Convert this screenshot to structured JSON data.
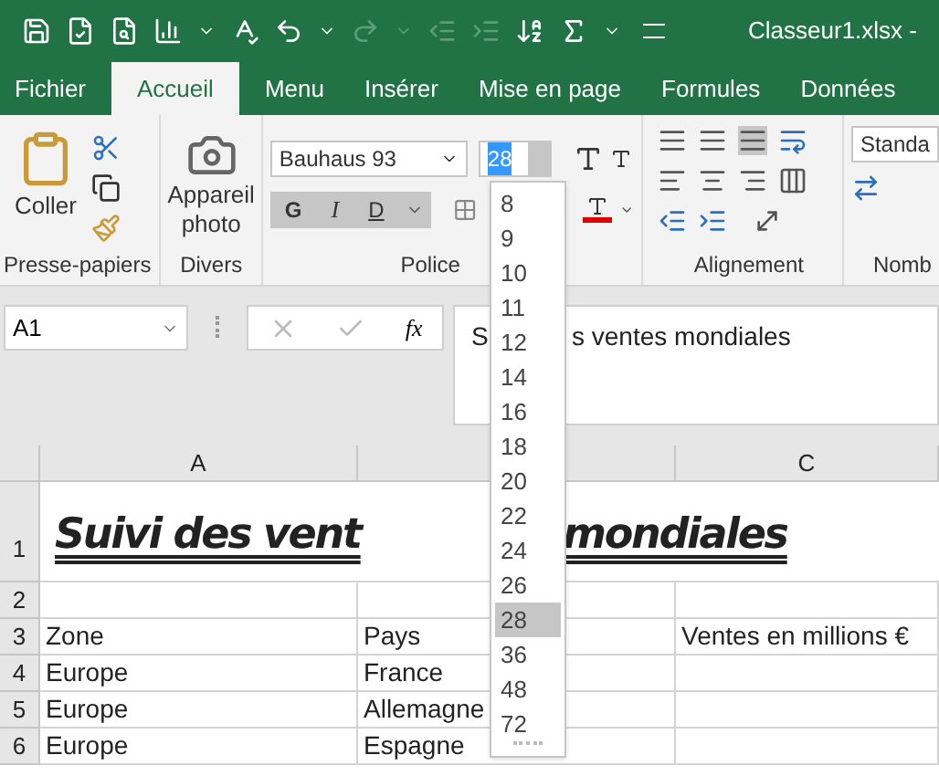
{
  "window": {
    "title": "Classeur1.xlsx -"
  },
  "tabs": [
    {
      "label": "Fichier",
      "selected": false
    },
    {
      "label": "Accueil",
      "selected": true
    },
    {
      "label": "Menu",
      "selected": false
    },
    {
      "label": "Insérer",
      "selected": false
    },
    {
      "label": "Mise en page",
      "selected": false
    },
    {
      "label": "Formules",
      "selected": false
    },
    {
      "label": "Données",
      "selected": false
    }
  ],
  "clipboard": {
    "paste_label": "Coller",
    "group_label": "Presse-papiers"
  },
  "misc": {
    "camera_label": "Appareil photo",
    "group_label": "Divers"
  },
  "font": {
    "name": "Bauhaus 93",
    "size": "28",
    "bold_label": "G",
    "italic_label": "I",
    "underline_label": "D",
    "group_label": "Police",
    "size_options": [
      {
        "label": "8",
        "selected": false
      },
      {
        "label": "9",
        "selected": false
      },
      {
        "label": "10",
        "selected": false
      },
      {
        "label": "11",
        "selected": false
      },
      {
        "label": "12",
        "selected": false
      },
      {
        "label": "14",
        "selected": false
      },
      {
        "label": "16",
        "selected": false
      },
      {
        "label": "18",
        "selected": false
      },
      {
        "label": "20",
        "selected": false
      },
      {
        "label": "22",
        "selected": false
      },
      {
        "label": "24",
        "selected": false
      },
      {
        "label": "26",
        "selected": false
      },
      {
        "label": "28",
        "selected": true
      },
      {
        "label": "36",
        "selected": false
      },
      {
        "label": "48",
        "selected": false
      },
      {
        "label": "72",
        "selected": false
      }
    ]
  },
  "alignment": {
    "group_label": "Alignement"
  },
  "number": {
    "format": "Standa",
    "group_label": "Nomb"
  },
  "formula_bar": {
    "name_box": "A1",
    "fx_label": "fx",
    "content_parts": [
      "S",
      "s ventes mondiales"
    ]
  },
  "sheet": {
    "columns": [
      {
        "label": "A"
      },
      {},
      {
        "label": "C"
      }
    ],
    "rows": [
      {
        "number": "1",
        "kind": "title",
        "title_parts": [
          "Suivi des vent",
          "mondiales"
        ]
      },
      {
        "number": "2",
        "kind": "cells"
      },
      {
        "number": "3",
        "kind": "cells",
        "cells": [
          "Zone",
          "Pays",
          "Ventes en millions €"
        ]
      },
      {
        "number": "4",
        "kind": "cells",
        "cells": [
          "Europe",
          "France"
        ]
      },
      {
        "number": "5",
        "kind": "cells",
        "cells": [
          "Europe",
          "Allemagne"
        ]
      },
      {
        "number": "6",
        "kind": "cells",
        "cells": [
          "Europe",
          "Espagne"
        ]
      }
    ]
  }
}
